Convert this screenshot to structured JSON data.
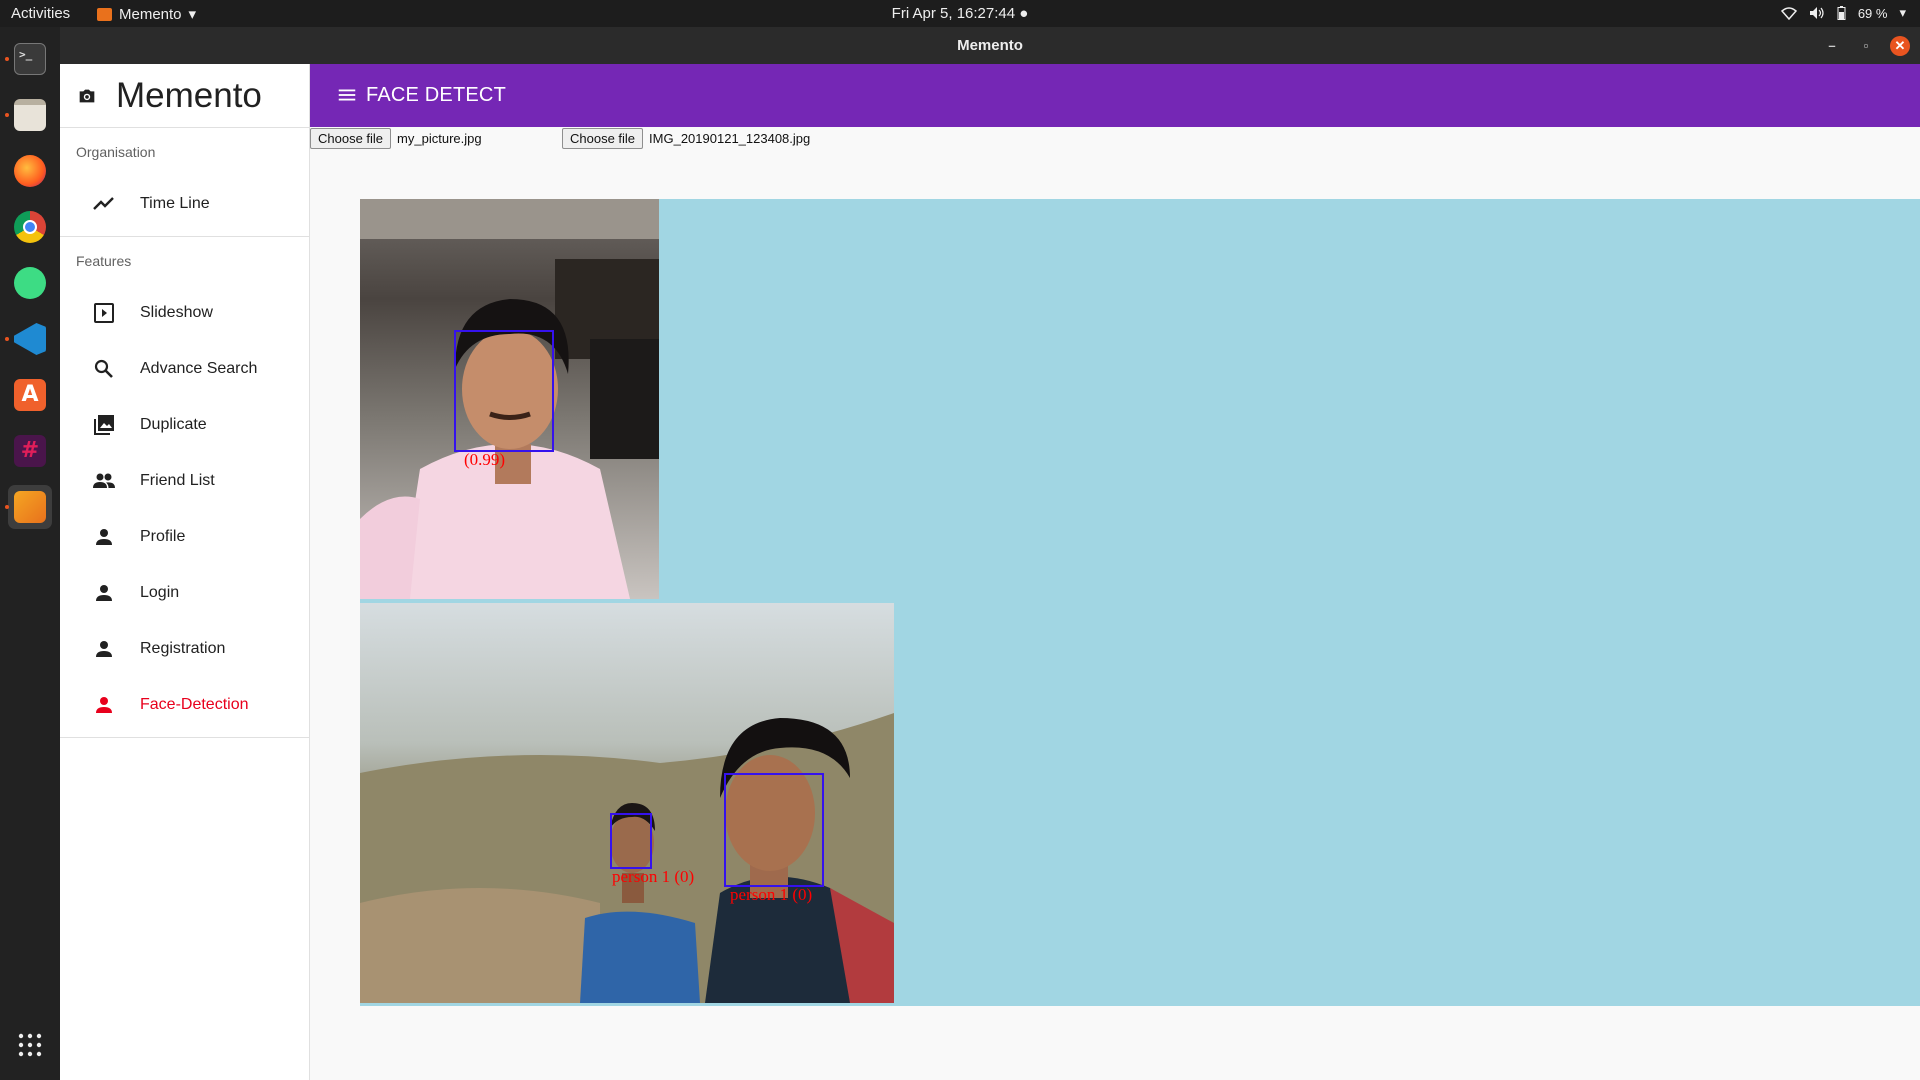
{
  "system": {
    "activities": "Activities",
    "app_name": "Memento",
    "clock": "Fri Apr  5, 16:27:44",
    "battery": "69 %"
  },
  "window": {
    "title": "Memento",
    "minimize": "–",
    "maximize": "▫",
    "close": "✕"
  },
  "dock": {
    "items": [
      "terminal-icon",
      "files-icon",
      "firefox-icon",
      "chrome-icon",
      "android-studio-icon",
      "vscode-icon",
      "software-center-icon",
      "slack-icon",
      "image-viewer-icon"
    ],
    "grid_label": "show-applications-icon"
  },
  "sidebar": {
    "brand": "Memento",
    "organisation_heading": "Organisation",
    "organisation_items": [
      {
        "label": "Time Line",
        "icon": "trending-icon"
      }
    ],
    "features_heading": "Features",
    "features_items": [
      {
        "label": "Slideshow",
        "icon": "slideshow-icon"
      },
      {
        "label": "Advance Search",
        "icon": "search-icon"
      },
      {
        "label": "Duplicate",
        "icon": "photo-library-icon"
      },
      {
        "label": "Friend List",
        "icon": "people-icon"
      },
      {
        "label": "Profile",
        "icon": "person-icon"
      },
      {
        "label": "Login",
        "icon": "person-icon"
      },
      {
        "label": "Registration",
        "icon": "person-icon"
      },
      {
        "label": "Face-Detection",
        "icon": "person-icon"
      }
    ],
    "selected_color": "#e8001c"
  },
  "appbar": {
    "title": "FACE DETECT",
    "color": "#7527b5"
  },
  "uploads": [
    {
      "button": "Choose file",
      "filename": "my_picture.jpg"
    },
    {
      "button": "Choose file",
      "filename": "IMG_20190121_123408.jpg"
    }
  ],
  "detections": {
    "image1": [
      {
        "label": "(0.99)"
      }
    ],
    "image2": [
      {
        "label": "person 1 (0)"
      },
      {
        "label": "person 1 (0)"
      }
    ]
  },
  "canvas_color": "#a1d6e3"
}
